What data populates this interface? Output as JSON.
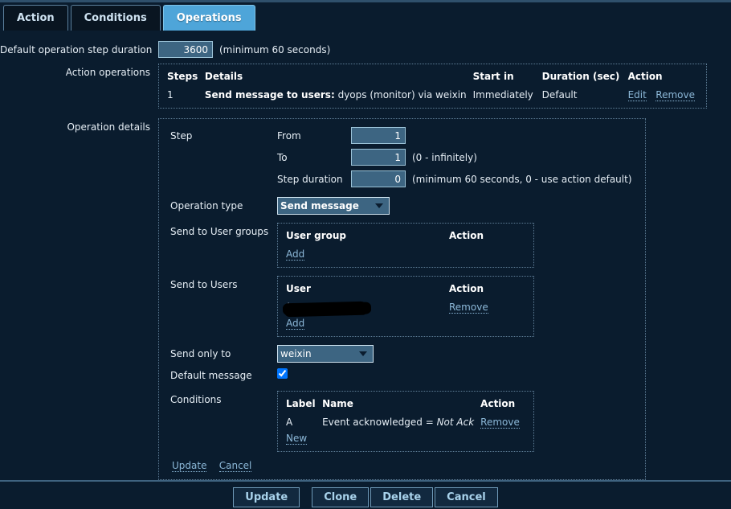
{
  "tabs": [
    {
      "label": "Action",
      "active": false
    },
    {
      "label": "Conditions",
      "active": false
    },
    {
      "label": "Operations",
      "active": true
    }
  ],
  "form": {
    "default_duration": {
      "label": "Default operation step duration",
      "value": "3600",
      "hint": "(minimum 60 seconds)"
    },
    "action_operations": {
      "label": "Action operations",
      "headers": [
        "Steps",
        "Details",
        "Start in",
        "Duration (sec)",
        "Action"
      ],
      "rows": [
        {
          "steps": "1",
          "details_bold": "Send message to users:",
          "details_rest": "dyops (monitor) via weixin",
          "start_in": "Immediately",
          "duration": "Default",
          "action_edit": "Edit",
          "action_remove": "Remove"
        }
      ]
    },
    "operation_details": {
      "label": "Operation details",
      "step": {
        "label": "Step",
        "from": {
          "label": "From",
          "value": "1"
        },
        "to": {
          "label": "To",
          "value": "1",
          "hint": "(0 - infinitely)"
        },
        "duration": {
          "label": "Step duration",
          "value": "0",
          "hint": "(minimum 60 seconds, 0 - use action default)"
        }
      },
      "operation_type": {
        "label": "Operation type",
        "value": "Send message",
        "options": [
          "Send message"
        ]
      },
      "user_groups": {
        "label": "Send to User groups",
        "headers": [
          "User group",
          "Action"
        ],
        "rows": [],
        "add_label": "Add"
      },
      "users": {
        "label": "Send to Users",
        "headers": [
          "User",
          "Action"
        ],
        "rows": [
          {
            "user": "(monitor)",
            "redacted": true,
            "action": "Remove"
          }
        ],
        "add_label": "Add"
      },
      "send_only_to": {
        "label": "Send only to",
        "value": "weixin",
        "options": [
          "weixin"
        ]
      },
      "default_message": {
        "label": "Default message",
        "checked": true
      },
      "conditions": {
        "label": "Conditions",
        "headers": [
          "Label",
          "Name",
          "Action"
        ],
        "rows": [
          {
            "label": "A",
            "name_prefix": "Event acknowledged = ",
            "name_value": "Not Ack",
            "action": "Remove"
          }
        ],
        "new_label": "New"
      },
      "update_label": "Update",
      "cancel_label": "Cancel"
    }
  },
  "footer": {
    "buttons": [
      {
        "label": "Update"
      },
      {
        "label": "Clone"
      },
      {
        "label": "Delete"
      },
      {
        "label": "Cancel"
      }
    ]
  },
  "colors": {
    "background": "#0a1c2e",
    "accent": "#4ea5d9",
    "link": "#8cb8d8",
    "input_bg": "#3d6582"
  }
}
